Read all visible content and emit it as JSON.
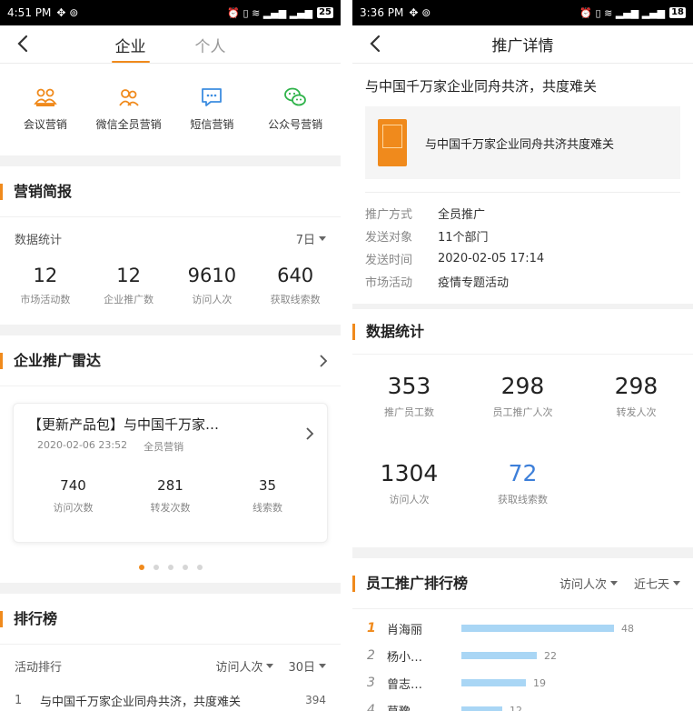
{
  "left": {
    "status": {
      "time": "4:51 PM",
      "battery": "25"
    },
    "tabs": [
      "企业",
      "个人"
    ],
    "quick": [
      {
        "label": "会议营销",
        "icon": "meeting-icon"
      },
      {
        "label": "微信全员营销",
        "icon": "wechat-staff-icon"
      },
      {
        "label": "短信营销",
        "icon": "sms-icon"
      },
      {
        "label": "公众号营销",
        "icon": "official-account-icon"
      }
    ],
    "brief": {
      "title": "营销简报",
      "stat_label": "数据统计",
      "period": "7日",
      "stats": [
        {
          "value": "12",
          "label": "市场活动数"
        },
        {
          "value": "12",
          "label": "企业推广数"
        },
        {
          "value": "9610",
          "label": "访问人次"
        },
        {
          "value": "640",
          "label": "获取线索数"
        }
      ]
    },
    "radar": {
      "title": "企业推广雷达",
      "card_title": "【更新产品包】与中国千万家…",
      "date": "2020-02-06 23:52",
      "type": "全员营销",
      "stats": [
        {
          "value": "740",
          "label": "访问次数"
        },
        {
          "value": "281",
          "label": "转发次数"
        },
        {
          "value": "35",
          "label": "线索数"
        }
      ]
    },
    "ranking": {
      "title": "排行榜",
      "sub": "活动排行",
      "metric": "访问人次",
      "period": "30日",
      "first": {
        "num": "1",
        "text": "与中国千万家企业同舟共济，共度难关",
        "value": "394"
      }
    }
  },
  "right": {
    "status": {
      "time": "3:36 PM",
      "battery": "18"
    },
    "nav_title": "推广详情",
    "title": "与中国千万家企业同舟共济，共度难关",
    "share_text": "与中国千万家企业同舟共济共度难关",
    "info": [
      {
        "k": "推广方式",
        "v": "全员推广"
      },
      {
        "k": "发送对象",
        "v": "11个部门"
      },
      {
        "k": "发送时间",
        "v": "2020-02-05 17:14"
      },
      {
        "k": "市场活动",
        "v": "疫情专题活动"
      }
    ],
    "data_stats": {
      "title": "数据统计",
      "items": [
        {
          "value": "353",
          "label": "推广员工数"
        },
        {
          "value": "298",
          "label": "员工推广人次"
        },
        {
          "value": "298",
          "label": "转发人次"
        },
        {
          "value": "1304",
          "label": "访问人次"
        },
        {
          "value": "72",
          "label": "获取线索数"
        }
      ]
    },
    "employee_rank": {
      "title": "员工推广排行榜",
      "metric": "访问人次",
      "period": "近七天",
      "rows": [
        {
          "rank": "1",
          "name": "肖海丽",
          "value": 48
        },
        {
          "rank": "2",
          "name": "杨小…",
          "value": 22
        },
        {
          "rank": "3",
          "name": "曾志…",
          "value": 19
        },
        {
          "rank": "4",
          "name": "莫豫…",
          "value": 12
        }
      ]
    }
  },
  "colors": {
    "accent": "#f08a1c",
    "blue": "#3d7fd9",
    "bar": "#a9d6f5"
  }
}
